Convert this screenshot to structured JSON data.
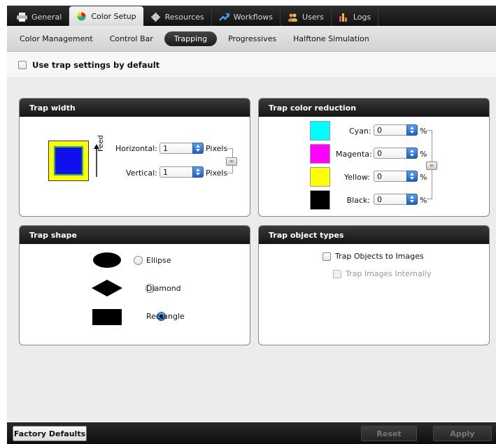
{
  "top_tabs": [
    {
      "label": "General",
      "icon": "printer-icon"
    },
    {
      "label": "Color Setup",
      "icon": "color-wheel-icon"
    },
    {
      "label": "Resources",
      "icon": "gear-icon"
    },
    {
      "label": "Workflows",
      "icon": "workflow-arrows-icon"
    },
    {
      "label": "Users",
      "icon": "users-icon"
    },
    {
      "label": "Logs",
      "icon": "bar-chart-icon"
    }
  ],
  "sub_tabs": [
    {
      "label": "Color Management"
    },
    {
      "label": "Control Bar"
    },
    {
      "label": "Trapping"
    },
    {
      "label": "Progressives"
    },
    {
      "label": "Halftone Simulation"
    }
  ],
  "default_checkbox": {
    "label": "Use trap settings by default",
    "checked": false
  },
  "trap_width": {
    "title": "Trap width",
    "feed_label": "Feed",
    "horizontal": {
      "label": "Horizontal:",
      "value": "1",
      "unit": "Pixels"
    },
    "vertical": {
      "label": "Vertical:",
      "value": "1",
      "unit": "Pixels"
    }
  },
  "trap_color_reduction": {
    "title": "Trap color reduction",
    "items": [
      {
        "label": "Cyan:",
        "value": "0",
        "unit": "%",
        "color": "#00ffff"
      },
      {
        "label": "Magenta:",
        "value": "0",
        "unit": "%",
        "color": "#ff00ff"
      },
      {
        "label": "Yellow:",
        "value": "0",
        "unit": "%",
        "color": "#ffff00"
      },
      {
        "label": "Black:",
        "value": "0",
        "unit": "%",
        "color": "#000000"
      }
    ]
  },
  "trap_shape": {
    "title": "Trap shape",
    "options": [
      {
        "label": "Ellipse",
        "selected": false
      },
      {
        "label": "Diamond",
        "selected": false
      },
      {
        "label": "Rectangle",
        "selected": true
      }
    ]
  },
  "trap_object_types": {
    "title": "Trap object types",
    "trap_objects": {
      "label": "Trap Objects to Images",
      "checked": false
    },
    "trap_images": {
      "label": "Trap Images Internally",
      "checked": false,
      "disabled": true
    }
  },
  "footer": {
    "factory_defaults": "Factory Defaults",
    "reset": "Reset",
    "apply": "Apply"
  }
}
